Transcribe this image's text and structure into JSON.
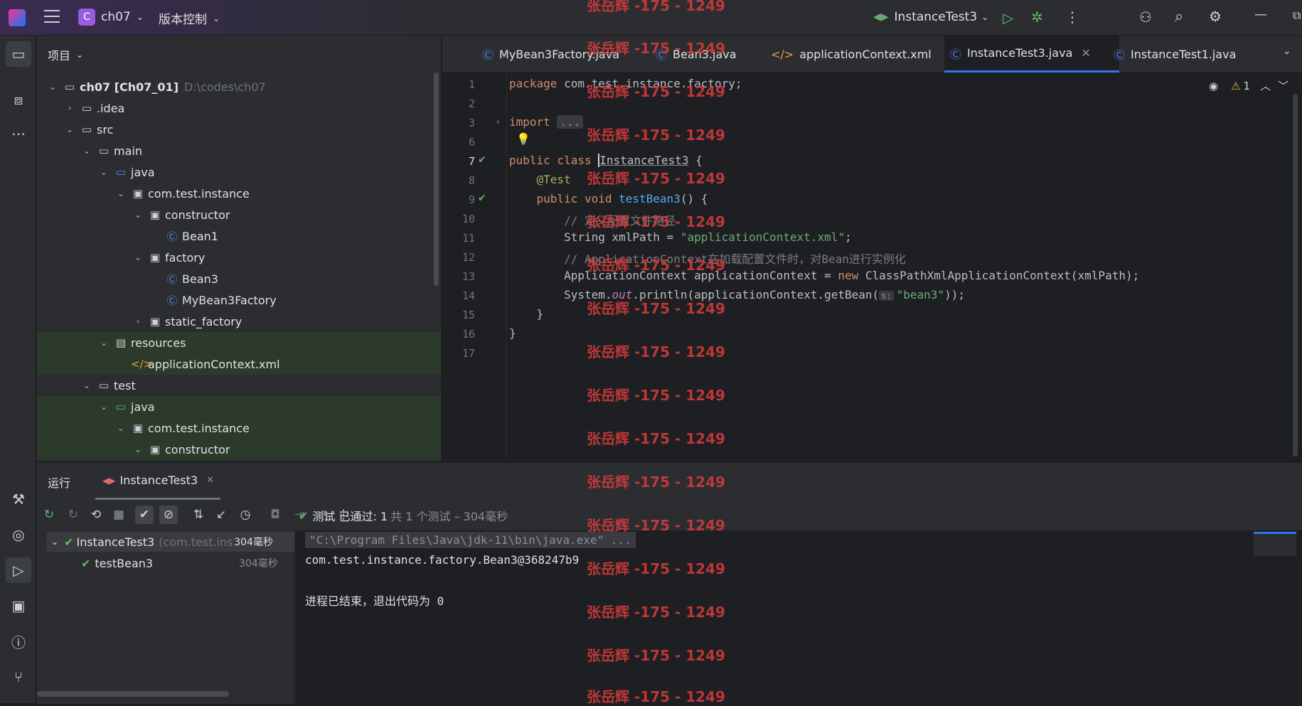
{
  "titlebar": {
    "project_initial": "C",
    "project_name": "ch07",
    "vcs_label": "版本控制",
    "run_config": "InstanceTest3"
  },
  "project_panel": {
    "title": "项目",
    "items": [
      {
        "label": "ch07 [Ch07_01]",
        "hint": "D:\\codes\\ch07"
      },
      {
        "label": ".idea"
      },
      {
        "label": "src"
      },
      {
        "label": "main"
      },
      {
        "label": "java"
      },
      {
        "label": "com.test.instance"
      },
      {
        "label": "constructor"
      },
      {
        "label": "Bean1"
      },
      {
        "label": "factory"
      },
      {
        "label": "Bean3"
      },
      {
        "label": "MyBean3Factory"
      },
      {
        "label": "static_factory"
      },
      {
        "label": "resources"
      },
      {
        "label": "applicationContext.xml"
      },
      {
        "label": "test"
      },
      {
        "label": "java"
      },
      {
        "label": "com.test.instance"
      },
      {
        "label": "constructor"
      }
    ]
  },
  "editor_tabs": [
    {
      "label": "MyBean3Factory.java"
    },
    {
      "label": "Bean3.java"
    },
    {
      "label": "applicationContext.xml"
    },
    {
      "label": "InstanceTest3.java"
    },
    {
      "label": "InstanceTest1.java"
    }
  ],
  "editor": {
    "warnings": "1",
    "line_numbers": [
      "1",
      "2",
      "3",
      "6",
      "7",
      "8",
      "9",
      "10",
      "11",
      "12",
      "13",
      "14",
      "15",
      "16",
      "17"
    ]
  },
  "code": {
    "l1a": "package",
    "l1b": " com.test.instance.factory;",
    "l3a": "import",
    "l3b": "...",
    "l7a": "public class ",
    "l7b": "InstanceTest3",
    " l7c": " {",
    "l7c": " {",
    "l8": "@Test",
    "l9a": "public void ",
    "l9b": "testBean3",
    "l9c": "() {",
    "l10": "// 定义配置文件路径",
    "l11a": "String xmlPath = ",
    "l11b": "\"applicationContext.xml\"",
    "l11c": ";",
    "l12": "// ApplicationContext在加载配置文件时，对Bean进行实例化",
    "l13a": "ApplicationContext applicationContext = ",
    "l13b": "new",
    "l13c": " ClassPathXmlApplicationContext(xmlPath);",
    "l14a": "System.",
    "l14b": "out",
    "l14c": ".println(applicationContext.getBean(",
    "l14hint": "s:",
    "l14d": "\"bean3\"",
    "l14e": "));",
    "l15": "}",
    "l16": "}"
  },
  "run": {
    "tab_title": "运行",
    "config": "InstanceTest3",
    "tree": [
      {
        "label": "InstanceTest3",
        "pkg": "(com.test.inst",
        "time": "304毫秒"
      },
      {
        "label": "testBean3",
        "time": "304毫秒"
      }
    ],
    "status": "测试 已通过: 1",
    "status_rest": "共 1 个测试 – 304毫秒",
    "console": [
      "\"C:\\Program Files\\Java\\jdk-11\\bin\\java.exe\" ...",
      "com.test.instance.factory.Bean3@368247b9",
      "",
      "进程已结束，退出代码为 0"
    ]
  },
  "watermark": "张岳辉 -175 - 1249",
  "colors": {
    "accent": "#3574f0",
    "success": "#5fb865",
    "watermark": "#d93c3c"
  }
}
